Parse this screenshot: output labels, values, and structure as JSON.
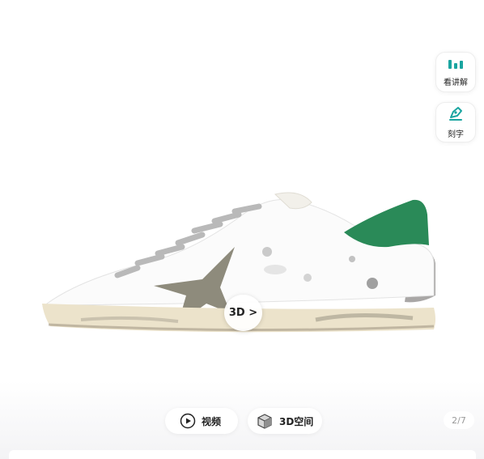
{
  "gallery": {
    "side_actions": [
      {
        "label": "看讲解",
        "icon": "bar-chart-icon",
        "color": "#1aa5a0"
      },
      {
        "label": "刻字",
        "icon": "pen-icon",
        "color": "#1aa5a0"
      }
    ],
    "badge_3d": "3D >",
    "media_tabs": [
      {
        "label": "视频",
        "icon": "play-icon"
      },
      {
        "label": "3D空间",
        "icon": "cube-icon"
      }
    ],
    "counter": "2/7"
  },
  "product": {
    "image": "white-sneaker-star-green-heel",
    "colors": {
      "star": "#8e8b7c",
      "heel": "#2a8a58",
      "sole": "#ece3cb"
    }
  }
}
